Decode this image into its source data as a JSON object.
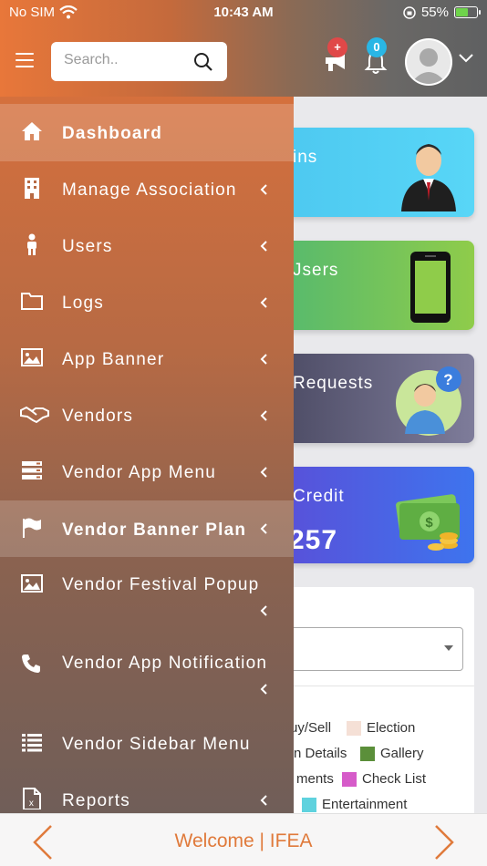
{
  "status": {
    "carrier": "No SIM",
    "time": "10:43 AM",
    "battery_pct": "55%",
    "battery_level": 0.55
  },
  "header": {
    "search_placeholder": "Search..",
    "announcement_badge": "+",
    "notification_badge": "0"
  },
  "dashboard": {
    "cards": [
      {
        "label": "ins",
        "value": ""
      },
      {
        "label": "Jsers",
        "value": ""
      },
      {
        "label": "Requests",
        "value": ""
      },
      {
        "label": "Credit",
        "value": "257"
      }
    ],
    "legend": [
      {
        "label": "uy/Sell",
        "color": ""
      },
      {
        "label": "Election",
        "color": "#f5e0d6"
      },
      {
        "label": "n Details",
        "color": ""
      },
      {
        "label": "Gallery",
        "color": "#5b8f3a"
      },
      {
        "label": "ments",
        "color": ""
      },
      {
        "label": "Check List",
        "color": "#d65bc9"
      },
      {
        "label": "Entertainment",
        "color": "#5fd2de"
      }
    ]
  },
  "sidebar": {
    "items": [
      {
        "label": "Dashboard",
        "icon": "home-icon",
        "active": true
      },
      {
        "label": "Manage Association",
        "icon": "building-icon"
      },
      {
        "label": "Users",
        "icon": "user-icon"
      },
      {
        "label": "Logs",
        "icon": "folder-icon"
      },
      {
        "label": "App Banner",
        "icon": "image-icon"
      },
      {
        "label": "Vendors",
        "icon": "handshake-icon"
      },
      {
        "label": "Vendor App Menu",
        "icon": "server-icon"
      },
      {
        "label": "Vendor Banner Plan",
        "icon": "flag-icon",
        "active": true
      },
      {
        "label": "Vendor Festival Popup",
        "icon": "image-icon"
      },
      {
        "label": "Vendor App Notification",
        "icon": "phone-icon"
      },
      {
        "label": "Vendor Sidebar Menu",
        "icon": "list-icon"
      },
      {
        "label": "Reports",
        "icon": "excel-file-icon"
      }
    ]
  },
  "footer": {
    "text": "Welcome | IFEA"
  },
  "colors": {
    "accent": "#e07a3b",
    "badge_red": "#e04848",
    "badge_blue": "#29b6e5"
  }
}
